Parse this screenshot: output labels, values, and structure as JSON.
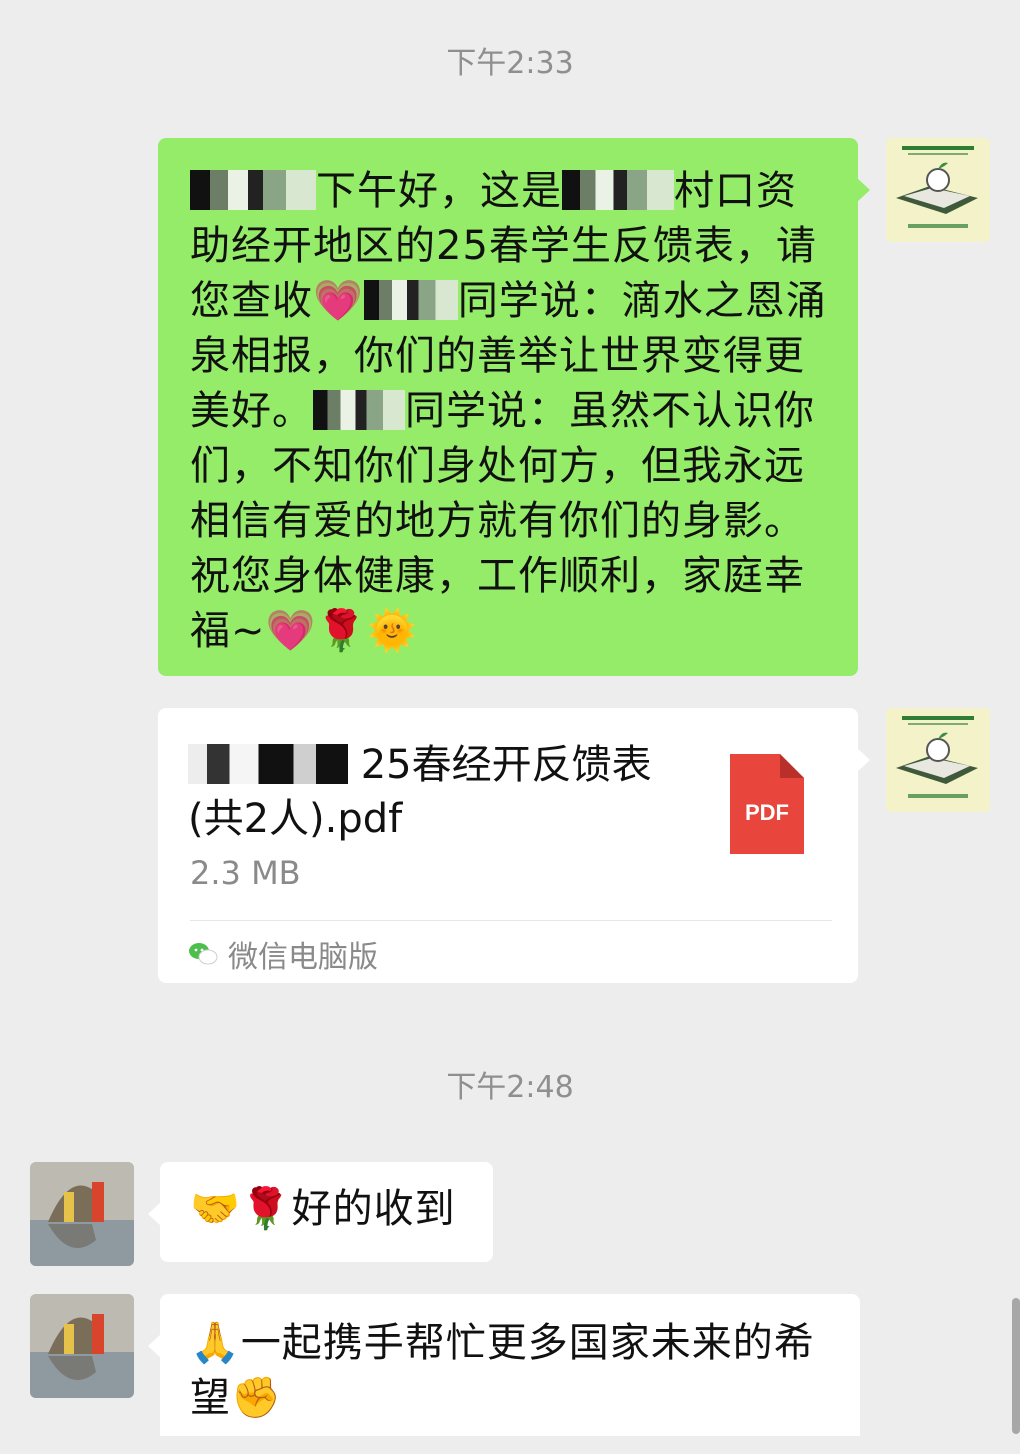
{
  "timestamps": [
    "下午2:33",
    "下午2:48"
  ],
  "messages": {
    "m1": {
      "seg1": "下午好，这是",
      "seg2": "村口资助经开地区的25春学生反馈表，请您查收",
      "emoji_heart": "💗",
      "seg3": "同学说：滴水之恩涌泉相报，你们的善举让世界变得更美好。",
      "seg4": "同学说：虽然不认识你们，不知你们身处何方，但我永远相信有爱的地方就有你们的身影。祝您身体健康，工作顺利，家庭幸福~",
      "emoji_end_heart": "💗",
      "emoji_rose": "🌹",
      "emoji_sun": "🌞"
    },
    "file": {
      "name_suffix": "25春经开反馈表",
      "name_line2": "(共2人).pdf",
      "size": "2.3 MB",
      "type_label": "PDF",
      "source": "微信电脑版"
    },
    "reply1": {
      "emoji_handshake": "🤝",
      "emoji_rose": "🌹",
      "text": "好的收到"
    },
    "reply2": {
      "emoji_pray": "🙏",
      "text": "一起携手帮忙更多国家未来的希望",
      "emoji_fist": "✊"
    }
  },
  "icons": {
    "org_avatar": "org-logo-avatar",
    "user_avatar": "photo-avatar",
    "wechat_icon": "wechat-icon",
    "pdf_icon": "pdf-file-icon"
  },
  "colors": {
    "sent_bubble": "#95ec69",
    "received_bubble": "#ffffff",
    "background": "#ededed",
    "pdf_red": "#e8453c"
  }
}
